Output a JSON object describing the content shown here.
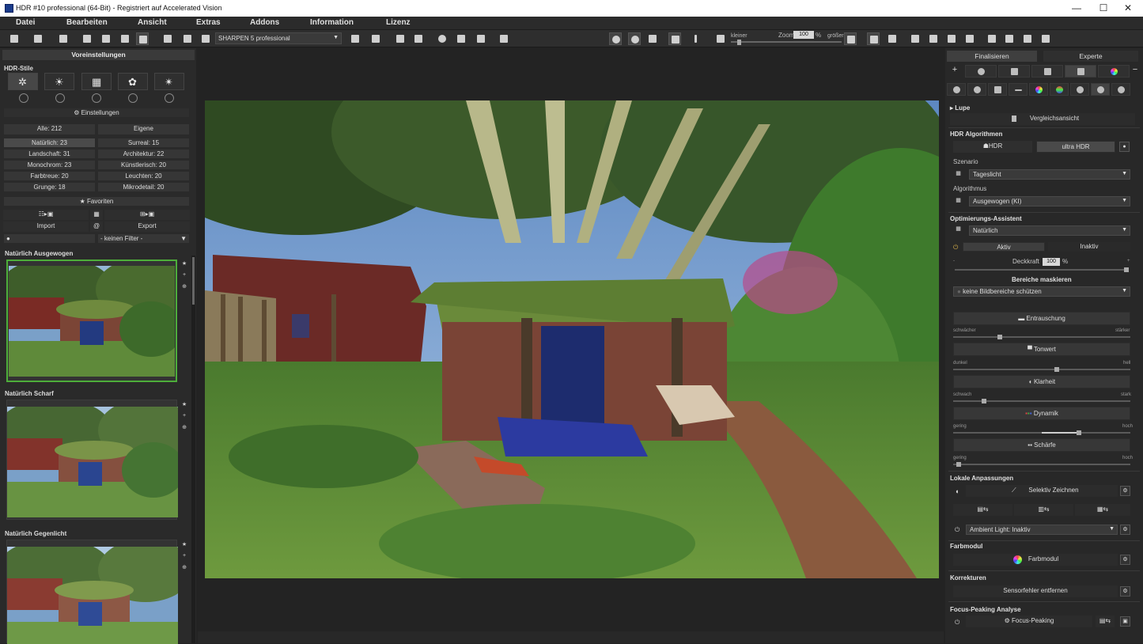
{
  "window": {
    "title": "HDR #10 professional (64-Bit) - Registriert auf Accelerated Vision",
    "controls": [
      "—",
      "☐",
      "✕"
    ]
  },
  "menu": [
    "Datei",
    "Bearbeiten",
    "Ansicht",
    "Extras",
    "Addons",
    "Information",
    "Lizenz"
  ],
  "toolbar": {
    "sharpen_select": "SHARPEN 5 professional",
    "zoom_label": "Zoom",
    "zoom_value": "100",
    "zoom_unit": "%",
    "smaller": "kleiner",
    "larger": "größer"
  },
  "left": {
    "panel_title": "Voreinstellungen",
    "hdr_styles_label": "HDR-Stile",
    "settings_button": "Einstellungen",
    "all_label": "Alle: 212",
    "own_label": "Eigene",
    "categories": [
      [
        "Natürlich: 23",
        "Surreal: 15"
      ],
      [
        "Landschaft: 31",
        "Architektur: 22"
      ],
      [
        "Monochrom: 23",
        "Künstlerisch: 20"
      ],
      [
        "Farbtreue: 20",
        "Leuchten: 20"
      ],
      [
        "Grunge: 18",
        "Mikrodetail: 20"
      ]
    ],
    "favorites": "★ Favoriten",
    "import": "Import",
    "at_symbol": "@",
    "export": "Export",
    "filter": "- keinen Filter -",
    "presets": [
      {
        "name": "Natürlich Ausgewogen"
      },
      {
        "name": "Natürlich Scharf"
      },
      {
        "name": "Natürlich Gegenlicht"
      }
    ]
  },
  "right": {
    "tabs": [
      "Finalisieren",
      "Experte"
    ],
    "lupe": "Lupe",
    "compare": "Vergleichsansicht",
    "hdr_algorithms": "HDR Algorithmen",
    "hdr_button": "HDR",
    "hdr_ultra": "ultra HDR",
    "scenario_label": "Szenario",
    "scenario_value": "Tageslicht",
    "algorithm_label": "Algorithmus",
    "algorithm_value": "Ausgewogen (KI)",
    "assistant_label": "Optimierungs-Assistent",
    "assistant_value": "Natürlich",
    "active": "Aktiv",
    "inactive": "Inaktiv",
    "opacity_label": "Deckkraft",
    "opacity_value": "100",
    "opacity_unit": "%",
    "mask_label": "Bereiche maskieren",
    "mask_value": "keine Bildbereiche schützen",
    "denoise": "Entrauschung",
    "denoise_lo": "schwächer",
    "denoise_hi": "stärker",
    "tone": "Tonwert",
    "tone_lo": "dunkel",
    "tone_hi": "hell",
    "clarity": "Klarheit",
    "clarity_lo": "schwach",
    "clarity_hi": "stark",
    "dynamic": "Dynamik",
    "dynamic_lo": "gering",
    "dynamic_hi": "hoch",
    "sharpness": "Schärfe",
    "sharp_lo": "gering",
    "sharp_hi": "hoch",
    "local_label": "Lokale Anpassungen",
    "selective": "Selektiv Zeichnen",
    "ambient": "Ambient Light: Inaktiv",
    "color_module_label": "Farbmodul",
    "color_module_btn": "Farbmodul",
    "corrections_label": "Korrekturen",
    "sensor_btn": "Sensorfehler entfernen",
    "focus_label": "Focus-Peaking Analyse",
    "focus_btn": "Focus-Peaking"
  }
}
